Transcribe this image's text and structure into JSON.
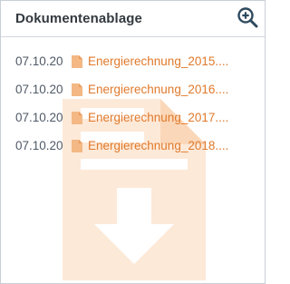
{
  "panel": {
    "title": "Dokumentenablage",
    "zoom_icon": "zoom-in-icon",
    "watermark_icon": "document-download-icon"
  },
  "documents": [
    {
      "date": "07.10.20",
      "icon": "file-icon",
      "name": "Energierechnung_2015...."
    },
    {
      "date": "07.10.20",
      "icon": "file-icon",
      "name": "Energierechnung_2016...."
    },
    {
      "date": "07.10.20",
      "icon": "file-icon",
      "name": "Energierechnung_2017...."
    },
    {
      "date": "07.10.20",
      "icon": "file-icon",
      "name": "Energierechnung_2018...."
    }
  ],
  "colors": {
    "accent": "#e07a2c",
    "title": "#33393f",
    "date": "#4f5966",
    "icon": "#2f4a5e",
    "watermark": "#fde9d8"
  }
}
